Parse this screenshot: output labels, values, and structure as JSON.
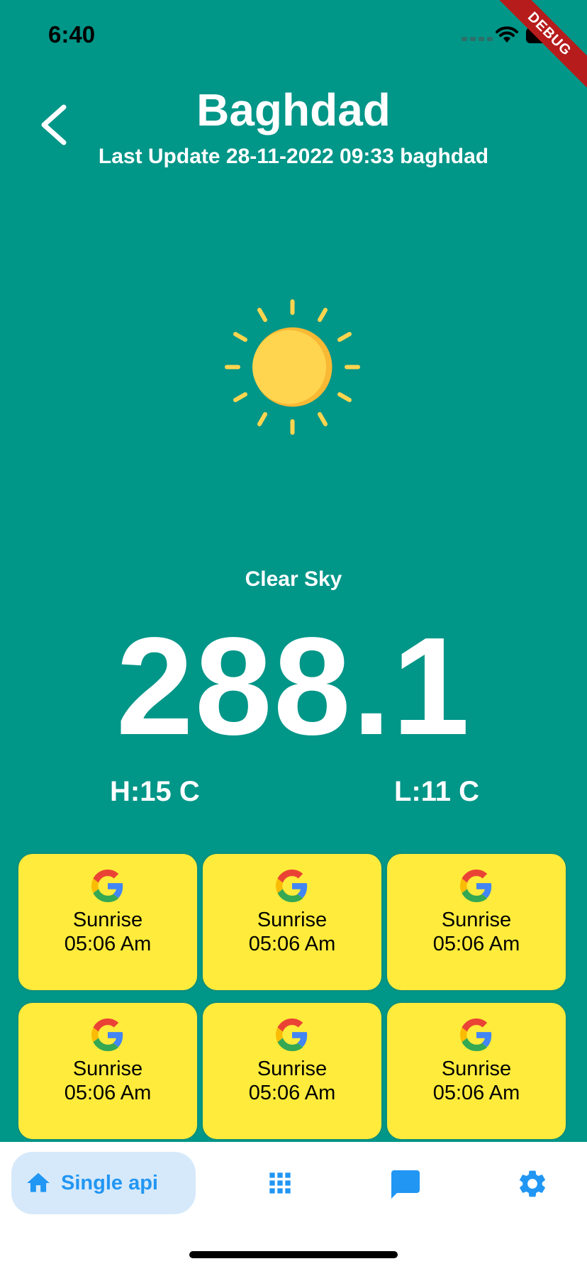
{
  "status_bar": {
    "time": "6:40"
  },
  "debug_banner": {
    "label": "DEBUG"
  },
  "header": {
    "city": "Baghdad",
    "last_update": "Last Update 28-11-2022 09:33 baghdad"
  },
  "weather": {
    "icon": "sun-icon",
    "condition": "Clear Sky",
    "temperature": "288.1",
    "high": "H:15 C",
    "low": "L:11 C"
  },
  "tiles": [
    {
      "icon": "google-icon",
      "label": "Sunrise",
      "time": "05:06 Am"
    },
    {
      "icon": "google-icon",
      "label": "Sunrise",
      "time": "05:06 Am"
    },
    {
      "icon": "google-icon",
      "label": "Sunrise",
      "time": "05:06 Am"
    },
    {
      "icon": "google-icon",
      "label": "Sunrise",
      "time": "05:06 Am"
    },
    {
      "icon": "google-icon",
      "label": "Sunrise",
      "time": "05:06 Am"
    },
    {
      "icon": "google-icon",
      "label": "Sunrise",
      "time": "05:06 Am"
    }
  ],
  "bottom_nav": {
    "active_label": "Single api",
    "items": [
      "home-icon",
      "grid-icon",
      "chat-icon",
      "settings-icon"
    ]
  },
  "colors": {
    "background": "#009688",
    "tile": "#ffeb3b",
    "accent": "#2196f3",
    "sun": "#ffd54f"
  }
}
